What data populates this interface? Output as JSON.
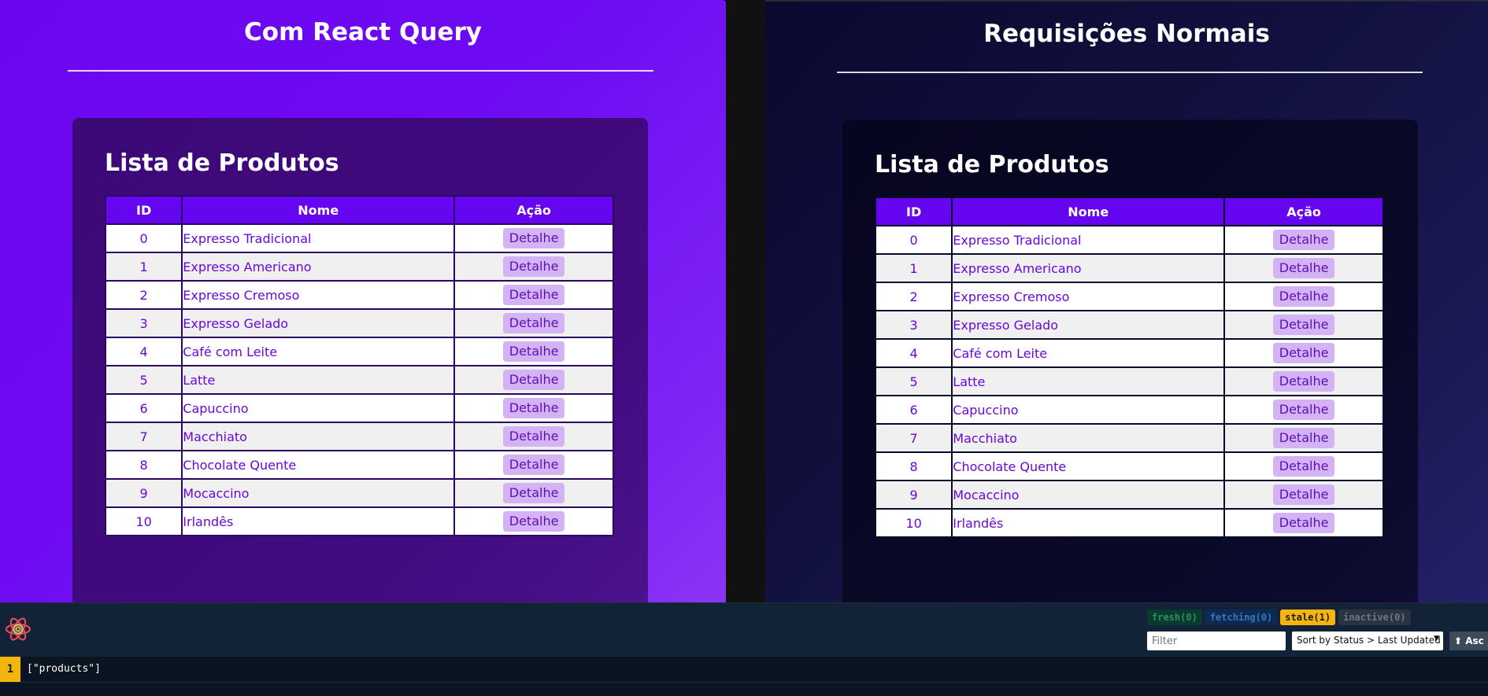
{
  "left_panel": {
    "title": "Com React Query",
    "card_title": "Lista de Produtos"
  },
  "right_panel": {
    "title": "Requisições Normais",
    "card_title": "Lista de Produtos"
  },
  "table": {
    "headers": [
      "ID",
      "Nome",
      "Ação"
    ],
    "action_label": "Detalhe",
    "rows": [
      {
        "id": "0",
        "name": "Expresso Tradicional"
      },
      {
        "id": "1",
        "name": "Expresso Americano"
      },
      {
        "id": "2",
        "name": "Expresso Cremoso"
      },
      {
        "id": "3",
        "name": "Expresso Gelado"
      },
      {
        "id": "4",
        "name": "Café com Leite"
      },
      {
        "id": "5",
        "name": "Latte"
      },
      {
        "id": "6",
        "name": "Capuccino"
      },
      {
        "id": "7",
        "name": "Macchiato"
      },
      {
        "id": "8",
        "name": "Chocolate Quente"
      },
      {
        "id": "9",
        "name": "Mocaccino"
      },
      {
        "id": "10",
        "name": "Irlandês"
      }
    ]
  },
  "devtools": {
    "logo_icon": "react-query-flower-icon",
    "badges": {
      "fresh": "fresh",
      "fresh_count": "(0)",
      "fetching": "fetching",
      "fetching_count": "(0)",
      "stale": "stale",
      "stale_count": "(1)",
      "inactive": "inactive",
      "inactive_count": "(0)"
    },
    "filter_placeholder": "Filter",
    "sort_label": "Sort by Status > Last Updated",
    "order_label": "⬆ Asc",
    "queries": [
      {
        "count": "1",
        "key": "[\"products\"]"
      }
    ]
  },
  "colors": {
    "left_bg": "#6c06f0",
    "right_bg": "#12113f",
    "table_header": "#6605ef",
    "text_purple": "#6a07d8",
    "button_bg": "#d4b3f4",
    "stale": "#f5b50f"
  }
}
